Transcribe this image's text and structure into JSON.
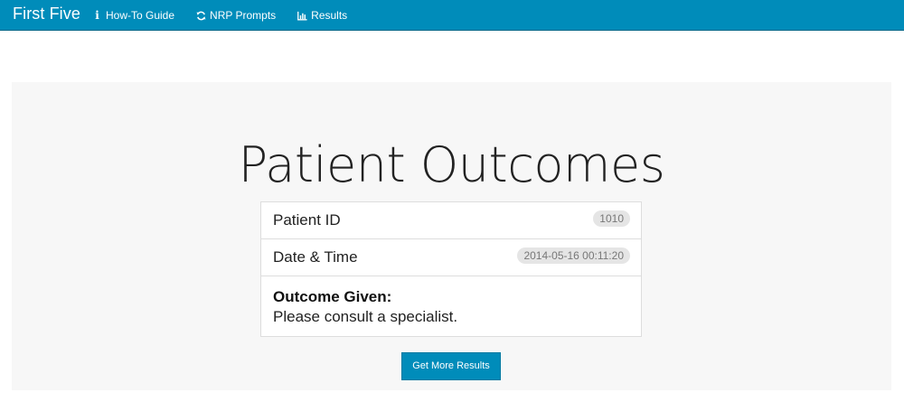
{
  "navbar": {
    "brand": "First Five",
    "links": [
      {
        "label": "How-To Guide",
        "icon": "info-icon"
      },
      {
        "label": "NRP Prompts",
        "icon": "refresh-icon"
      },
      {
        "label": "Results",
        "icon": "bar-chart-icon"
      }
    ]
  },
  "main": {
    "title": "Patient Outcomes",
    "patient_id_label": "Patient ID",
    "patient_id_value": "1010",
    "datetime_label": "Date & Time",
    "datetime_value": "2014-05-16 00:11:20",
    "outcome_heading": "Outcome Given:",
    "outcome_text": "Please consult a specialist.",
    "button_label": "Get More Results"
  },
  "colors": {
    "navbar": "#008cba",
    "panel_background": "#f7f7f7",
    "button": "#008cba",
    "badge": "#e5e5e5"
  }
}
